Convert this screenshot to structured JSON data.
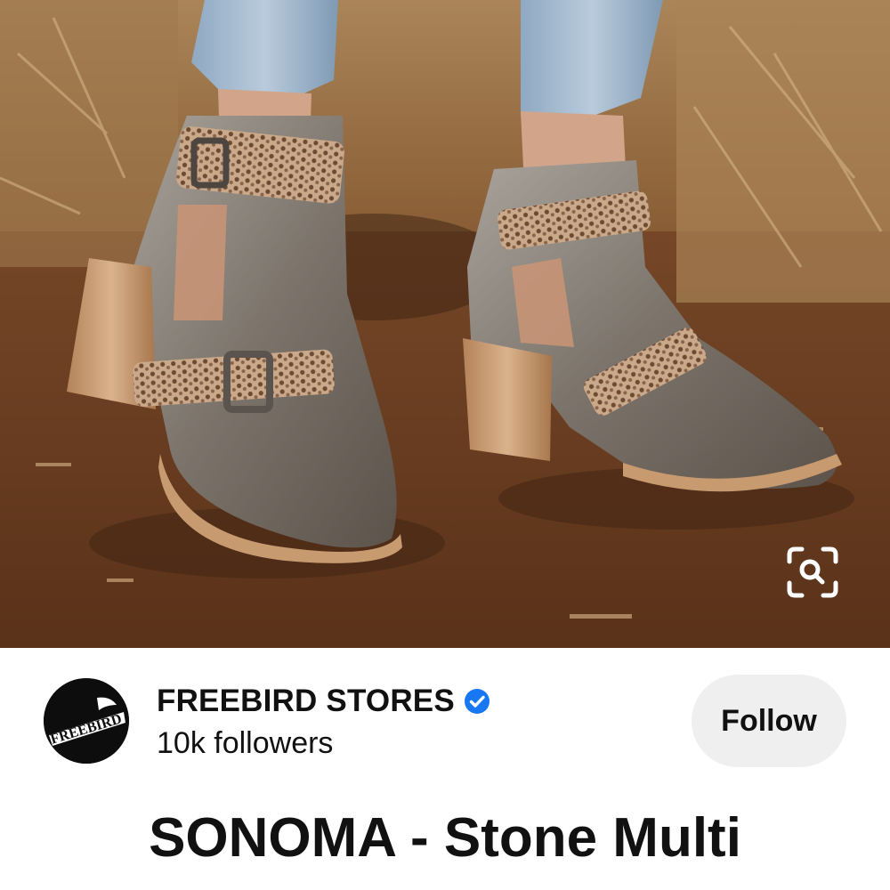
{
  "pin": {
    "image_description_icon": "visual-search-icon",
    "lens_button_icon": "visual-search-icon"
  },
  "creator": {
    "name": "FREEBIRD STORES",
    "verified_icon": "verified-badge-icon",
    "followers": "10k followers",
    "follow_label": "Follow",
    "avatar_text": "FREEBIRD"
  },
  "product": {
    "title": "SONOMA - Stone Multi"
  },
  "colors": {
    "verified": "#1877f2",
    "follow_button_bg": "#efefef",
    "text": "#111111"
  }
}
